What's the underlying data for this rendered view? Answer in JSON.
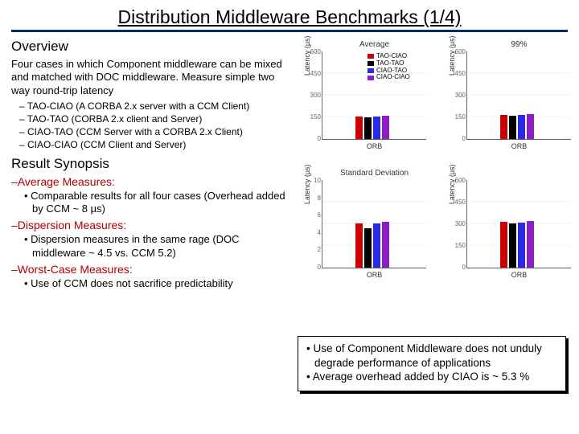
{
  "title": "Distribution Middleware Benchmarks (1/4)",
  "overview": {
    "heading": "Overview",
    "para": "Four cases in which Component middleware can be mixed and matched with DOC middleware. Measure simple two way round-trip latency",
    "cases": [
      "– TAO-CIAO (A CORBA 2.x server with a CCM Client)",
      "– TAO-TAO (CORBA 2.x client and Server)",
      "– CIAO-TAO (CCM Server with a CORBA 2.x Client)",
      "– CIAO-CIAO (CCM Client and Server)"
    ]
  },
  "synopsis": {
    "heading": "Result Synopsis",
    "avg_h": "–Average Measures:",
    "avg_b": "• Comparable results for all four cases (Overhead added by CCM ~ 8 µs)",
    "disp_h": "–Dispersion Measures:",
    "disp_b": "• Dispersion measures in the same rage (DOC middleware ~ 4.5 vs. CCM 5.2)",
    "worst_h": "–Worst-Case Measures:",
    "worst_b": "• Use of CCM does not sacrifice predictability"
  },
  "callout": {
    "l1": "• Use of Component Middleware does not unduly degrade performance of applications",
    "l2": "• Average overhead added by CIAO is ~ 5.3 %"
  },
  "legend": [
    "TAO-CIAO",
    "TAO-TAO",
    "CIAO-TAO",
    "CIAO-CIAO"
  ],
  "colors": {
    "c0": "#cc0000",
    "c1": "#000000",
    "c2": "#2a2ae6",
    "c3": "#8a1fc6"
  },
  "chart_data": [
    {
      "type": "bar",
      "title": "Average",
      "xlabel": "ORB",
      "ylabel": "Latency (µs)",
      "categories": [
        "TAO-CIAO",
        "TAO-TAO",
        "CIAO-TAO",
        "CIAO-CIAO"
      ],
      "values": [
        155,
        150,
        155,
        160
      ],
      "ylim": [
        0,
        600
      ],
      "yticks": [
        600,
        450,
        300,
        150,
        0
      ]
    },
    {
      "type": "bar",
      "title": "99%",
      "xlabel": "ORB",
      "ylabel": "Latency (µs)",
      "categories": [
        "TAO-CIAO",
        "TAO-TAO",
        "CIAO-TAO",
        "CIAO-CIAO"
      ],
      "values": [
        165,
        160,
        165,
        168
      ],
      "ylim": [
        0,
        600
      ],
      "yticks": [
        600,
        450,
        300,
        150,
        0
      ]
    },
    {
      "type": "bar",
      "title": "Standard Deviation",
      "xlabel": "ORB",
      "ylabel": "Latency (µs)",
      "categories": [
        "TAO-CIAO",
        "TAO-TAO",
        "CIAO-TAO",
        "CIAO-CIAO"
      ],
      "values": [
        5.0,
        4.5,
        5.0,
        5.2
      ],
      "ylim": [
        0,
        10
      ],
      "yticks": [
        10,
        8,
        6,
        4,
        2,
        0
      ]
    },
    {
      "type": "bar",
      "title": "",
      "xlabel": "ORB",
      "ylabel": "Latency (µs)",
      "categories": [
        "TAO-CIAO",
        "TAO-TAO",
        "CIAO-TAO",
        "CIAO-CIAO"
      ],
      "values": [
        310,
        300,
        305,
        315
      ],
      "ylim": [
        0,
        600
      ],
      "yticks": [
        600,
        450,
        300,
        150,
        0
      ]
    }
  ]
}
